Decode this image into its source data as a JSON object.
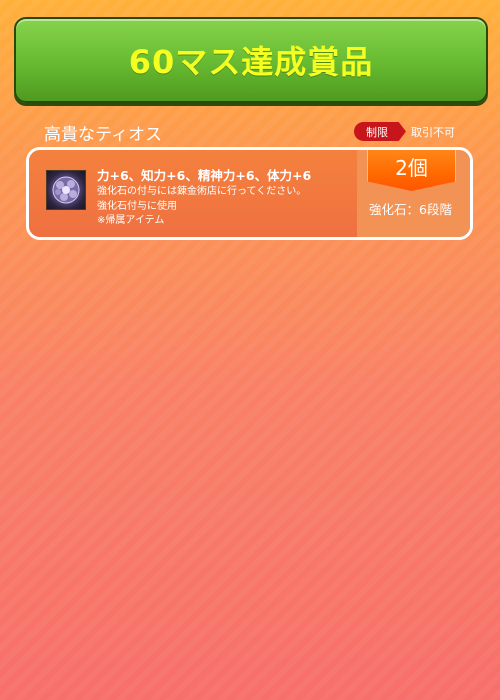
{
  "banner": {
    "title": "60マス達成賞品"
  },
  "reward": {
    "name": "高貴なティオス",
    "restriction_badge": "制限",
    "restriction_text": "取引不可",
    "item": {
      "icon": "purple-orb-icon",
      "stats": "力+6、知力+6、精神力+6、体力+6",
      "description_lines": [
        "強化石の付与には錬金術店に行ってください。",
        "強化石付与に使用",
        "※帰属アイテム"
      ],
      "quantity": "2個",
      "enhancement": "強化石：6段階"
    }
  },
  "colors": {
    "banner_green": "#6cc035",
    "title_yellow": "#f4ff22",
    "restriction_red": "#c8151b",
    "ribbon_orange": "#ff6a00"
  }
}
